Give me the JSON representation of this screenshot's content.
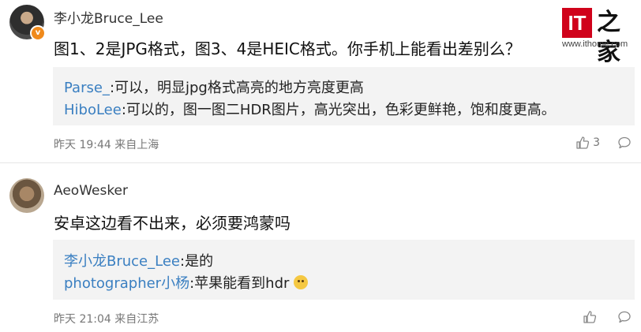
{
  "logo": {
    "mark": "IT",
    "hanzi": "之家",
    "url": "www.ithome.com"
  },
  "comments": [
    {
      "username": "李小龙Bruce_Lee",
      "verified_icon": "verified-badge-icon",
      "text": "图1、2是JPG格式，图3、4是HEIC格式。你手机上能看出差别么？",
      "replies": [
        {
          "name": "Parse_",
          "text": ":可以，明显jpg格式高亮的地方亮度更高"
        },
        {
          "name": "HiboLee",
          "text": ":可以的，图一图二HDR图片，高光突出，色彩更鲜艳，饱和度更高。"
        }
      ],
      "time": "昨天 19:44",
      "location": "来自上海",
      "likes": "3"
    },
    {
      "username": "AeoWesker",
      "text": "安卓这边看不出来，必须要鸿蒙吗",
      "replies": [
        {
          "name": "李小龙Bruce_Lee",
          "text": ":是的"
        },
        {
          "name": "photographer小杨",
          "text": ":苹果能看到hdr"
        }
      ],
      "time": "昨天 21:04",
      "location": "来自江苏",
      "likes": ""
    }
  ]
}
